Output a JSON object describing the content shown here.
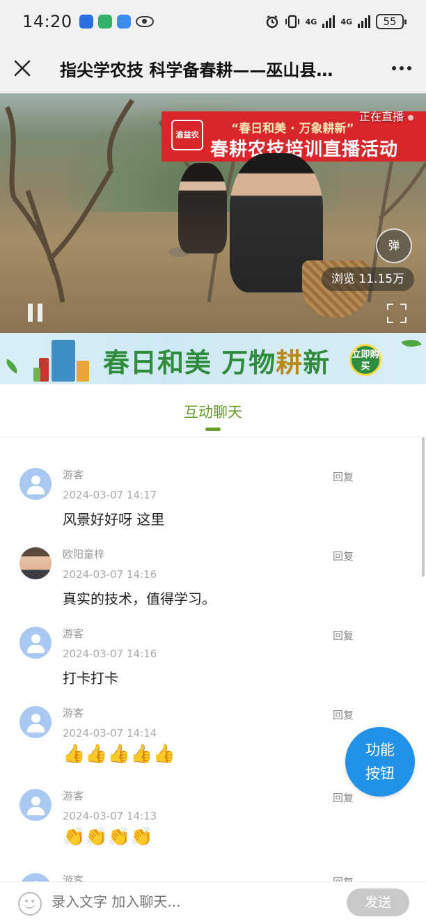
{
  "status_bar": {
    "time": "14:20",
    "network_1": "4G",
    "network_2": "4G",
    "battery": "55"
  },
  "nav": {
    "title": "指尖学农技 科学备春耕——巫山县…"
  },
  "video": {
    "banner_line1": "“春日和美 · 万象耕新”",
    "banner_line2": "春耕农技培训直播活动",
    "banner_logo": "渝益农",
    "live_status": "正在直播",
    "danmu_label": "弹",
    "views": "浏览 11.15万"
  },
  "ad": {
    "text_part1": "春日和美 万物",
    "text_highlight": "耕",
    "text_part2": "新",
    "cta": "立即购买"
  },
  "tabs": {
    "chat": "互动聊天"
  },
  "messages": [
    {
      "name": "游客",
      "time": "2024-03-07 14:17",
      "text": "风景好好呀 这里",
      "reply": "回复"
    },
    {
      "name": "欧阳童梓",
      "time": "2024-03-07 14:16",
      "text": "真实的技术，值得学习。",
      "reply": "回复"
    },
    {
      "name": "游客",
      "time": "2024-03-07 14:16",
      "text": "打卡打卡",
      "reply": "回复"
    },
    {
      "name": "游客",
      "time": "2024-03-07 14:14",
      "text": "👍👍👍👍👍",
      "reply": "回复"
    },
    {
      "name": "游客",
      "time": "2024-03-07 14:13",
      "text": "👏👏👏👏",
      "reply": "回复"
    },
    {
      "name": "游客",
      "time": "",
      "text": "",
      "reply": "回复"
    }
  ],
  "fab": {
    "line1": "功能",
    "line2": "按钮"
  },
  "input": {
    "placeholder": "录入文字 加入聊天...",
    "send": "发送"
  },
  "colors": {
    "accent_green": "#6a9a2e",
    "fab_blue": "#2192e8",
    "avatar_blue": "#a9c9f2",
    "banner_red": "#d8262b"
  }
}
